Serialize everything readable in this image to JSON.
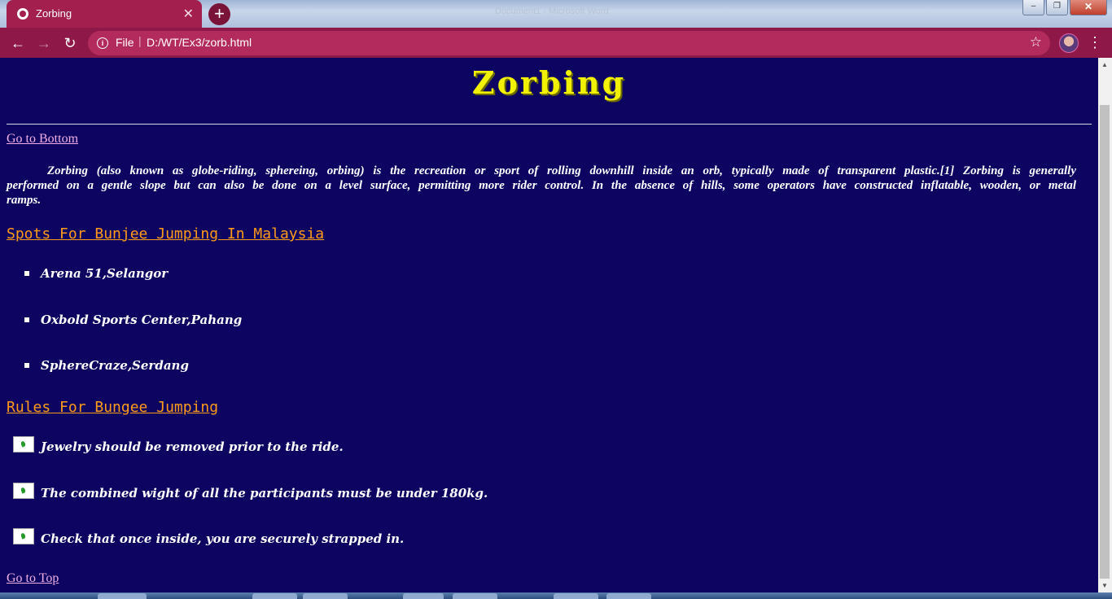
{
  "browser": {
    "tab_title": "Zorbing",
    "tab_close": "✕",
    "new_tab": "+",
    "window_title": "Document1 - Microsoft Word",
    "address_scheme": "File",
    "address_url": "D:/WT/Ex3/zorb.html",
    "accent_color": "#8e1847"
  },
  "page": {
    "title": "Zorbing",
    "go_bottom": "Go to Bottom",
    "intro": "Zorbing (also known as globe-riding, sphereing, orbing) is the recreation or sport of rolling downhill inside an orb, typically made of transparent plastic.[1] Zorbing is generally performed on a gentle slope but can also be done on a level surface, permitting more rider control. In the absence of hills, some operators have constructed inflatable, wooden, or metal ramps.",
    "spots_heading": "Spots For Bunjee Jumping In Malaysia",
    "spots": [
      "Arena 51,Selangor",
      "Oxbold Sports Center,Pahang",
      "SphereCraze,Serdang"
    ],
    "rules_heading": "Rules For Bungee Jumping",
    "rules": [
      "Jewelry should be removed prior to the ride.",
      "The combined wight of all the participants must be under 180kg.",
      "Check that once inside, you are securely strapped in."
    ],
    "go_top": "Go to Top",
    "background_color": "#0c0460",
    "title_color": "#f2f200",
    "heading_color": "#ff9a1a"
  }
}
